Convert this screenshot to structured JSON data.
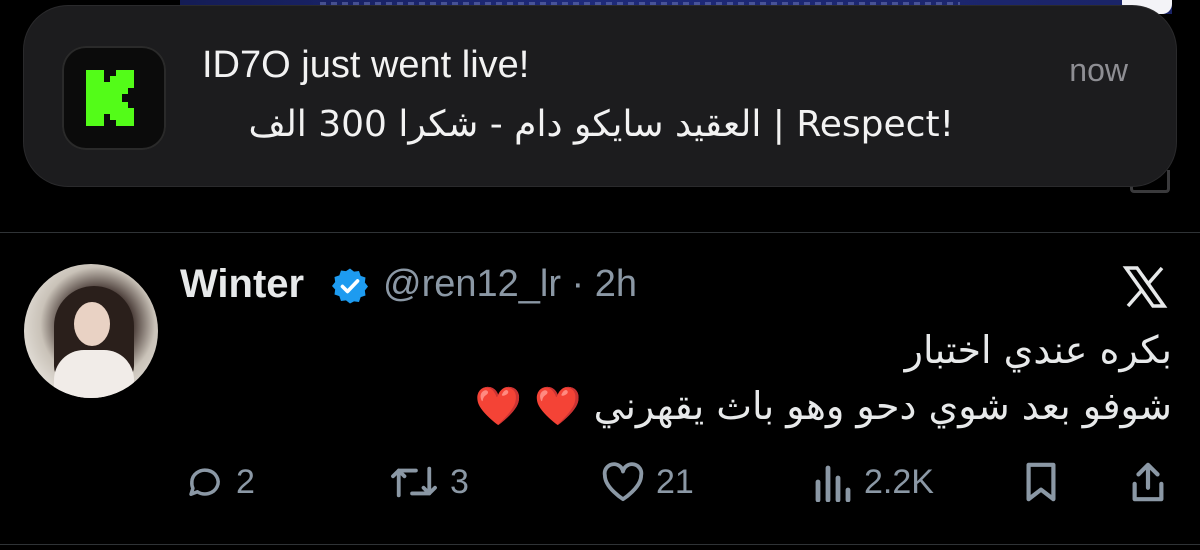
{
  "notification": {
    "title": "ID7O just went live!",
    "body": "العقيد سايكو دام - شكرا 300 الف | Respect!",
    "time": "now",
    "app_icon": "kick-logo-icon",
    "accent_color": "#53fc18"
  },
  "tweet": {
    "name": "Winter",
    "handle_time": "@ren12_lr · 2h",
    "verified": true,
    "verified_color": "#1d9bf0",
    "text_line1": "بكره عندي اختبار",
    "text_line2": "شوفو بعد شوي دحو وهو باث يقهرني ❤️ ❤️",
    "actions": {
      "replies": "2",
      "reposts": "3",
      "likes": "21",
      "views": "2.2K"
    }
  }
}
